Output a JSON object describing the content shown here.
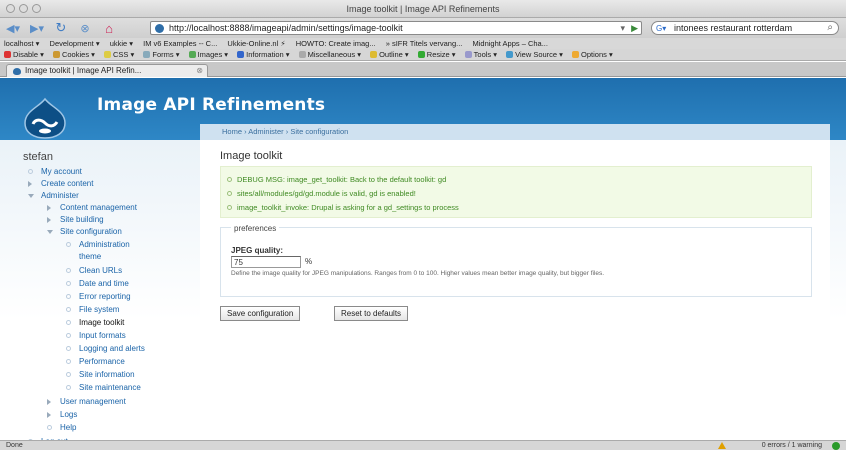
{
  "browser": {
    "window_title": "Image toolkit | Image API Refinements",
    "url": "http://localhost:8888/imageapi/admin/settings/image-toolkit",
    "search_text": "intonees restaurant rotterdam",
    "tab_title": "Image toolkit | Image API Refin...",
    "bookmarks": [
      "localhost ▾",
      "Development ▾",
      "ukkie ▾",
      "IM v6 Examples -- C...",
      "Ukkie-Online.nl ⚡",
      "HOWTO: Create imag...",
      "» sIFR Titels vervang...",
      "Midnight Apps – Cha..."
    ],
    "devtools": [
      "Disable ▾",
      "Cookies ▾",
      "CSS ▾",
      "Forms ▾",
      "Images ▾",
      "Information ▾",
      "Miscellaneous ▾",
      "Outline ▾",
      "Resize ▾",
      "Tools ▾",
      "View Source ▾",
      "Options ▾"
    ],
    "status_left": "Done",
    "status_right": "0 errors / 1 warning"
  },
  "site": {
    "name": "Image API Refinements",
    "breadcrumb": "Home › Administer › Site configuration"
  },
  "sidebar": {
    "username": "stefan",
    "items": [
      {
        "label": "My account"
      },
      {
        "label": "Create content"
      },
      {
        "label": "Administer"
      },
      {
        "label": "Content management"
      },
      {
        "label": "Site building"
      },
      {
        "label": "Site configuration"
      },
      {
        "label": "Administration"
      },
      {
        "label": "theme"
      },
      {
        "label": "Clean URLs"
      },
      {
        "label": "Date and time"
      },
      {
        "label": "Error reporting"
      },
      {
        "label": "File system"
      },
      {
        "label": "Image toolkit"
      },
      {
        "label": "Input formats"
      },
      {
        "label": "Logging and alerts"
      },
      {
        "label": "Performance"
      },
      {
        "label": "Site information"
      },
      {
        "label": "Site maintenance"
      },
      {
        "label": "User management"
      },
      {
        "label": "Logs"
      },
      {
        "label": "Help"
      },
      {
        "label": "Log out"
      }
    ]
  },
  "main": {
    "title": "Image toolkit",
    "messages": [
      "DEBUG MSG: image_get_toolkit: Back to the default toolkit: gd",
      "sites/all/modules/gd/gd.module is valid, gd is enabled!",
      "image_toolkit_invoke: Drupal is asking for a gd_settings to process"
    ],
    "fieldset_legend": "preferences",
    "jpeg_label": "JPEG quality:",
    "jpeg_value": "75",
    "jpeg_suffix": "%",
    "jpeg_description": "Define the image quality for JPEG manipulations. Ranges from 0 to 100. Higher values mean better image quality, but bigger files.",
    "save_label": "Save configuration",
    "reset_label": "Reset to defaults"
  },
  "colors": {
    "header_blue": "#2e87c6",
    "link_blue": "#1b64a8",
    "message_green": "#3f8a22"
  }
}
